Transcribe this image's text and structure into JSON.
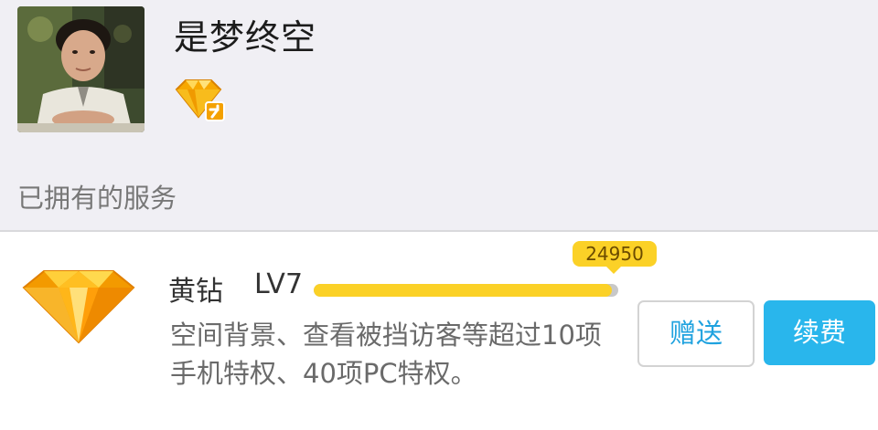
{
  "profile": {
    "username": "是梦终空",
    "avatar_icon": "user-avatar-photo",
    "badge_icon": "yellow-diamond-badge-icon"
  },
  "section": {
    "label": "已拥有的服务"
  },
  "service": {
    "icon": "yellow-diamond-icon",
    "name": "黄钻",
    "level": "LV7",
    "points": "24950",
    "progress_fraction": 0.98,
    "description": "空间背景、查看被挡访客等超过10项\n手机特权、40项PC特权。",
    "gift_label": "赠送",
    "renew_label": "续费"
  },
  "colors": {
    "header_bg": "#f0eff4",
    "accent_yellow": "#fbd127",
    "button_blue": "#29b6ec",
    "link_blue": "#1fa2df"
  }
}
